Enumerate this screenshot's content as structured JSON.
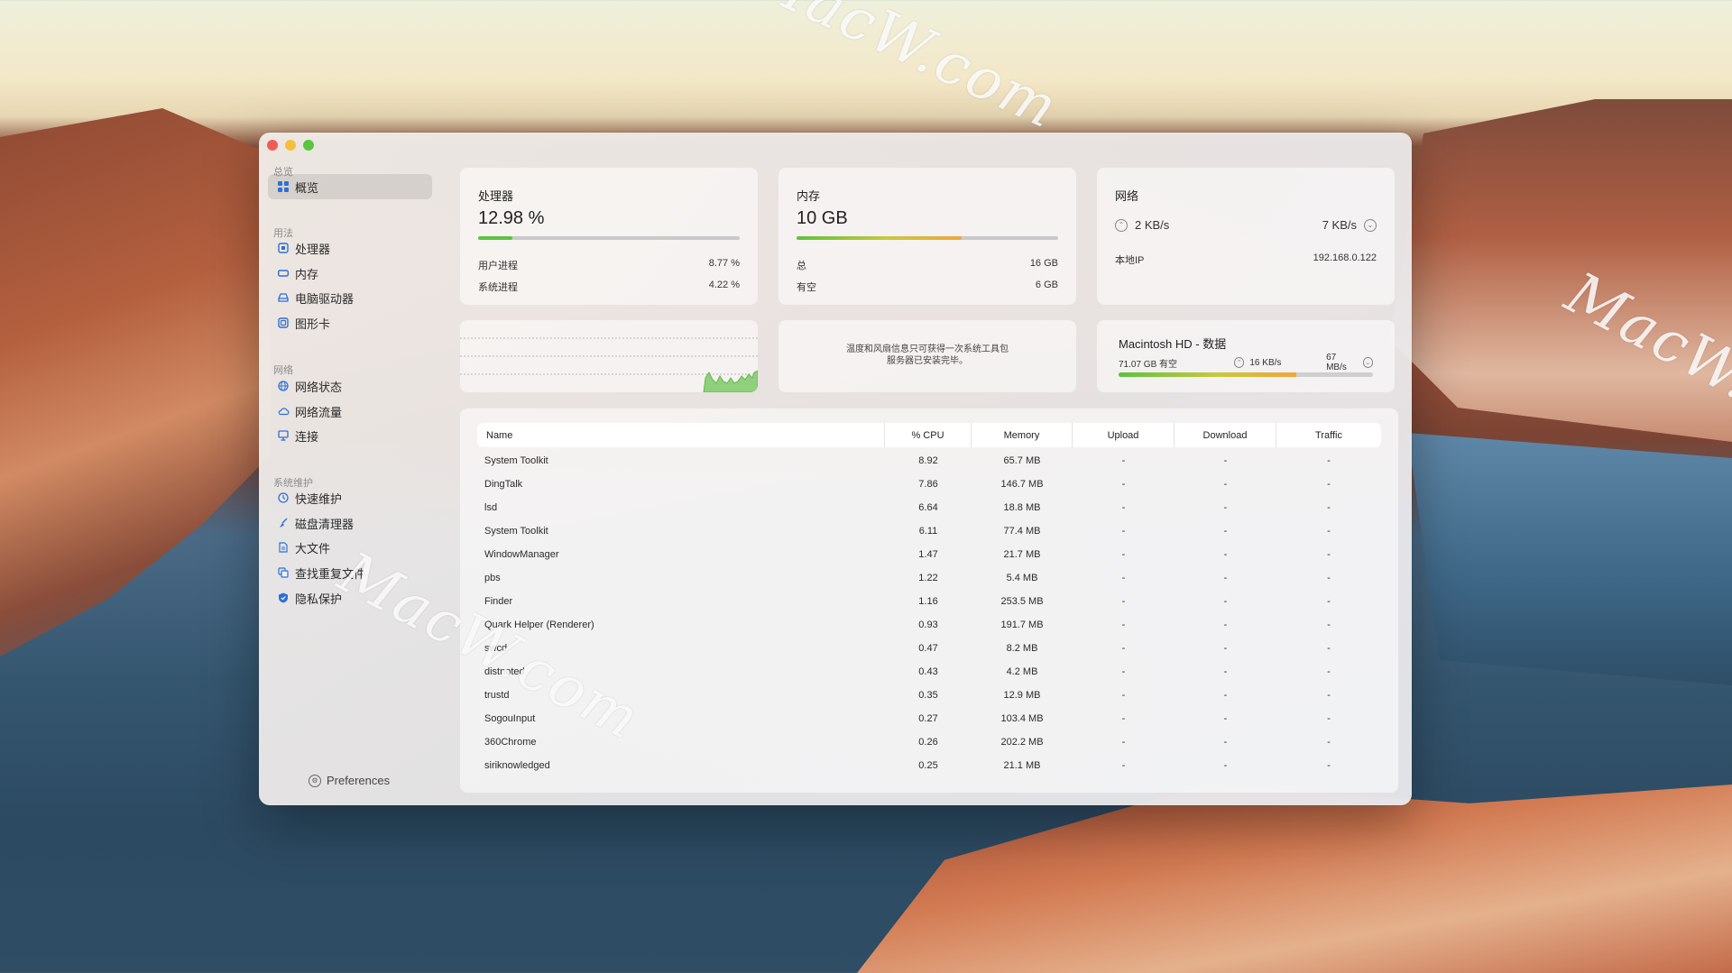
{
  "sidebar": {
    "sections": [
      "总览",
      "用法",
      "网络",
      "系统维护"
    ],
    "items": [
      {
        "label": "概览",
        "icon": "grid-icon"
      },
      {
        "label": "处理器",
        "icon": "cpu-icon"
      },
      {
        "label": "内存",
        "icon": "memory-icon"
      },
      {
        "label": "电脑驱动器",
        "icon": "drive-icon"
      },
      {
        "label": "图形卡",
        "icon": "gpu-icon"
      },
      {
        "label": "网络状态",
        "icon": "globe-icon"
      },
      {
        "label": "网络流量",
        "icon": "cloud-icon"
      },
      {
        "label": "连接",
        "icon": "monitor-icon"
      },
      {
        "label": "快速维护",
        "icon": "clock-icon"
      },
      {
        "label": "磁盘清理器",
        "icon": "broom-icon"
      },
      {
        "label": "大文件",
        "icon": "document-icon"
      },
      {
        "label": "查找重复文件",
        "icon": "duplicate-icon"
      },
      {
        "label": "隐私保护",
        "icon": "shield-icon"
      }
    ],
    "preferences": "Preferences"
  },
  "cpu": {
    "title": "处理器",
    "value": "12.98 %",
    "progress": 0.13,
    "user_label": "用户进程",
    "user_value": "8.77 %",
    "system_label": "系统进程",
    "system_value": "4.22 %"
  },
  "memory": {
    "title": "内存",
    "value": "10 GB",
    "progress": 0.63,
    "total_label": "总",
    "total_value": "16 GB",
    "free_label": "有空",
    "free_value": "6 GB"
  },
  "network": {
    "title": "网络",
    "upload": "2 KB/s",
    "download": "7 KB/s",
    "ip_label": "本地IP",
    "ip_value": "192.168.0.122"
  },
  "sensors": {
    "message_line1": "温度和风扇信息只可获得一次系统工具包",
    "message_line2": "服务器已安装完毕。"
  },
  "disk": {
    "title": "Macintosh HD - 数据",
    "free": "71.07 GB 有空",
    "read": "16 KB/s",
    "write": "67 MB/s",
    "progress": 0.7
  },
  "colors": {
    "accent": "#2e6fd8",
    "bar_green": "#5cc23f",
    "bar_orange": "#f0a63c"
  },
  "table": {
    "headers": [
      "Name",
      "% CPU",
      "Memory",
      "Upload",
      "Download",
      "Traffic"
    ],
    "rows": [
      [
        "System Toolkit",
        "8.92",
        "65.7 MB",
        "-",
        "-",
        "-"
      ],
      [
        "DingTalk",
        "7.86",
        "146.7 MB",
        "-",
        "-",
        "-"
      ],
      [
        "lsd",
        "6.64",
        "18.8 MB",
        "-",
        "-",
        "-"
      ],
      [
        "System Toolkit",
        "6.11",
        "77.4 MB",
        "-",
        "-",
        "-"
      ],
      [
        "WindowManager",
        "1.47",
        "21.7 MB",
        "-",
        "-",
        "-"
      ],
      [
        "pbs",
        "1.22",
        "5.4 MB",
        "-",
        "-",
        "-"
      ],
      [
        "Finder",
        "1.16",
        "253.5 MB",
        "-",
        "-",
        "-"
      ],
      [
        "Quark Helper (Renderer)",
        "0.93",
        "191.7 MB",
        "-",
        "-",
        "-"
      ],
      [
        "swcd",
        "0.47",
        "8.2 MB",
        "-",
        "-",
        "-"
      ],
      [
        "distnoted",
        "0.43",
        "4.2 MB",
        "-",
        "-",
        "-"
      ],
      [
        "trustd",
        "0.35",
        "12.9 MB",
        "-",
        "-",
        "-"
      ],
      [
        "SogouInput",
        "0.27",
        "103.4 MB",
        "-",
        "-",
        "-"
      ],
      [
        "360Chrome",
        "0.26",
        "202.2 MB",
        "-",
        "-",
        "-"
      ],
      [
        "siriknowledged",
        "0.25",
        "21.1 MB",
        "-",
        "-",
        "-"
      ]
    ]
  },
  "watermark": "MacW.com"
}
